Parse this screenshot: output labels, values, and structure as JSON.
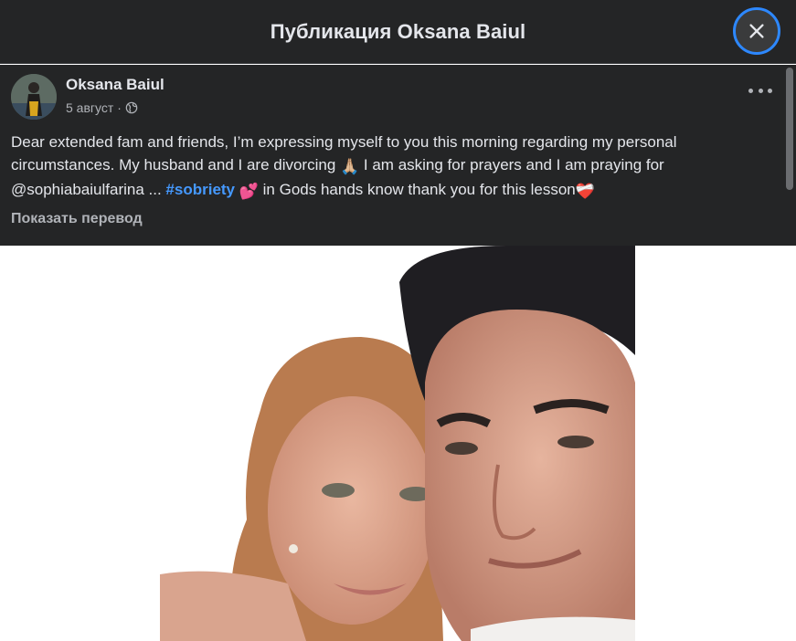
{
  "dialog": {
    "title": "Публикация Oksana Baiul",
    "close_icon": "close-icon"
  },
  "post": {
    "author": "Oksana Baiul",
    "date": "5 август",
    "separator": "·",
    "privacy_icon": "globe-icon",
    "more_icon": "more-options-icon",
    "text": {
      "part1": "Dear extended fam and friends, I’m expressing myself to you this morning regarding my personal circumstances.  My husband and I are divorcing ",
      "emoji1": "🙏🏼",
      "part2": " I am asking for prayers and I am praying for @sophiabaiulfarina ... ",
      "hashtag": "#sobriety",
      "emoji2": "💕",
      "part3": " in Gods hands know thank you for this lesson",
      "emoji3": "❤️‍🩹"
    },
    "translate_label": "Показать перевод"
  },
  "colors": {
    "header_bg": "#242526",
    "text_primary": "#e4e6eb",
    "text_secondary": "#b0b3b8",
    "link": "#4599ff",
    "focus_ring": "#2d88ff"
  }
}
